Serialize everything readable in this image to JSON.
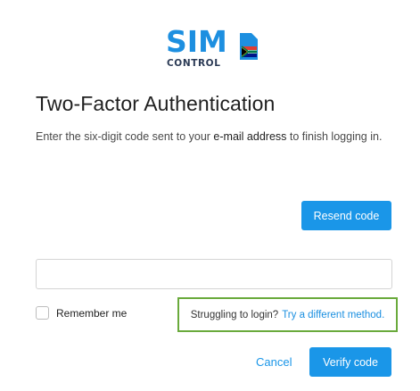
{
  "logo": {
    "sim_text": "SIM",
    "control_text": "CONTROL",
    "brand_color": "#1d8fe0",
    "secondary_color": "#2b3a55",
    "icon": "sim-card-sa-flag-icon"
  },
  "heading": {
    "title": "Two-Factor Authentication"
  },
  "description": {
    "before": "Enter the six-digit code sent to your ",
    "emphasis": "e-mail address",
    "after": " to finish logging in."
  },
  "actions": {
    "resend_label": "Resend code",
    "verify_label": "Verify code",
    "cancel_label": "Cancel",
    "accent_color": "#1a96e8"
  },
  "code_field": {
    "value": "",
    "placeholder": ""
  },
  "remember": {
    "label": "Remember me",
    "checked": false
  },
  "help": {
    "prompt": "Struggling to login?",
    "link_label": "Try a different method.",
    "highlight_color": "#6aaa3c"
  }
}
